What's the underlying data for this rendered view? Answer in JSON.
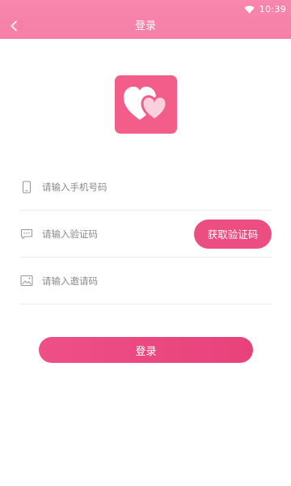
{
  "status_bar": {
    "time": "10:39",
    "wifi_icon": "wifi-icon"
  },
  "header": {
    "title": "登录",
    "back_icon": "chevron-left-icon"
  },
  "logo": {
    "icon": "hearts-logo-icon",
    "background": "#f25d8a"
  },
  "form": {
    "phone": {
      "icon": "phone-icon",
      "placeholder": "请输入手机号码",
      "value": ""
    },
    "code": {
      "icon": "message-icon",
      "placeholder": "请输入验证码",
      "value": "",
      "button_label": "获取验证码"
    },
    "invite": {
      "icon": "image-icon",
      "placeholder": "请输入邀请码",
      "value": ""
    }
  },
  "submit": {
    "label": "登录"
  },
  "colors": {
    "header_bg": "#f886ad",
    "accent": "#ec4e82",
    "divider": "#ececec"
  }
}
